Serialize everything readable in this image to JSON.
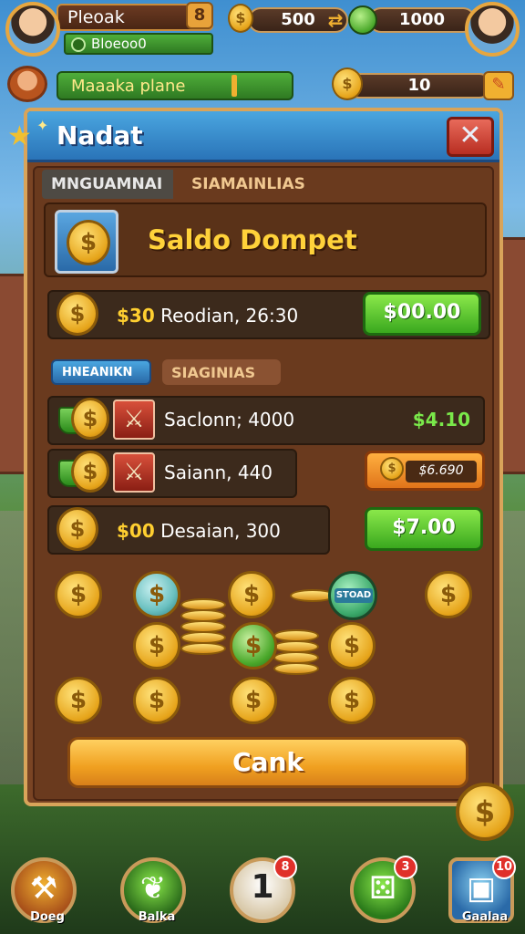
{
  "hud": {
    "player_name": "Pleoak",
    "player_sub": "Bloeoo0",
    "coins": "500",
    "gems": "1000",
    "quest_label": "Maaaka plane",
    "quest_count": "10"
  },
  "panel": {
    "title": "Nadat",
    "tab_active": "MNGUAMNAI",
    "tab_inactive": "SIAMAINLIAS",
    "wallet_title": "Saldo Dompet",
    "balance_row": {
      "amount": "$30",
      "label": "Reodian, 26:30",
      "button": "$00.00"
    },
    "subtab_active": "HNEANIKN",
    "subtab_inactive": "SIAGINIAS",
    "history": [
      {
        "label": "Saclonn; 4000",
        "value": "$4.10"
      },
      {
        "label": "Saiann, 440",
        "button": "$6.690"
      }
    ],
    "deposit_row": {
      "amount": "$00",
      "label": "Desaian, 300",
      "button": "$7.00"
    },
    "coin_badge": "STOAD",
    "action_button": "Cank"
  },
  "nav": {
    "items": [
      {
        "label": "Doeg",
        "icon": "hammer-icon"
      },
      {
        "label": "Balka",
        "icon": "leaf-icon"
      },
      {
        "label": "",
        "icon": "number-one-icon",
        "glyph": "1",
        "badge": "8"
      },
      {
        "label": "",
        "icon": "dice-icon",
        "badge": "3"
      },
      {
        "label": "Gaalaa",
        "icon": "box-icon",
        "badge": "10"
      }
    ]
  },
  "colors": {
    "accent_gold": "#f0a020",
    "accent_green": "#3aa81e",
    "header_blue": "#2a74b8",
    "panel_brown": "#7a4424"
  }
}
